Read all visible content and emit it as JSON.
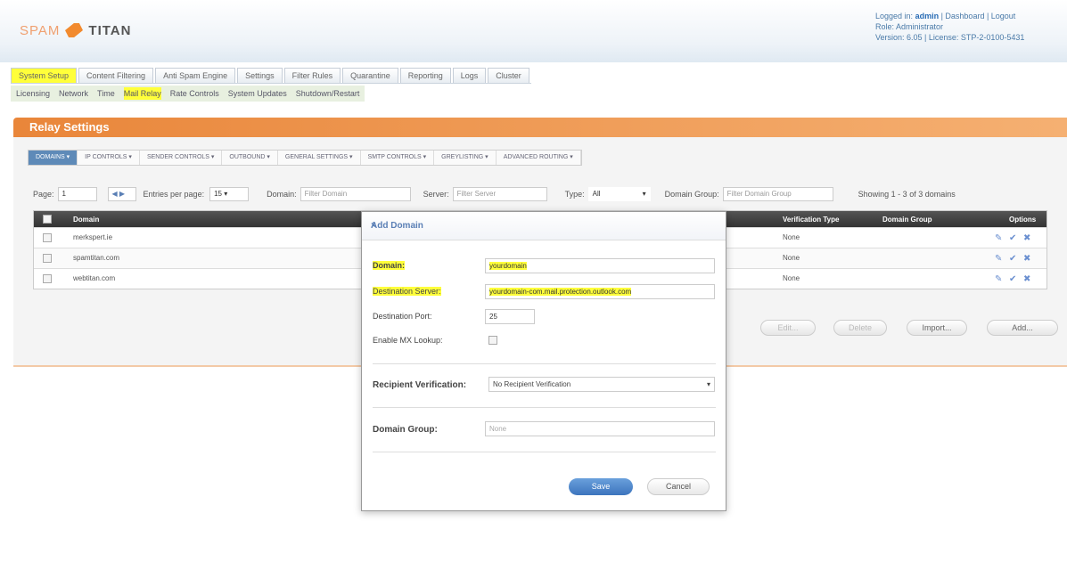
{
  "header": {
    "logo_spam": "SPAM",
    "logo_titan": "TITAN",
    "logged_in_prefix": "Logged in:",
    "logged_in_user": "admin",
    "logged_in_links": " | Dashboard | Logout",
    "role": "Role: Administrator",
    "version": "Version: 6.05 | License: STP-2-0100-5431"
  },
  "main_nav": [
    "System Setup",
    "Content Filtering",
    "Anti Spam Engine",
    "Settings",
    "Filter Rules",
    "Quarantine",
    "Reporting",
    "Logs",
    "Cluster"
  ],
  "sub_nav": [
    "Licensing",
    "Network",
    "Time",
    "Mail Relay",
    "Rate Controls",
    "System Updates",
    "Shutdown/Restart"
  ],
  "panel": {
    "title": "Relay Settings",
    "toolbar": [
      "DOMAINS ▾",
      "IP CONTROLS ▾",
      "SENDER CONTROLS ▾",
      "OUTBOUND ▾",
      "GENERAL SETTINGS ▾",
      "SMTP CONTROLS ▾",
      "GREYLISTING ▾",
      "ADVANCED ROUTING ▾"
    ],
    "filters": {
      "page_label": "Page:",
      "page_value": "1",
      "entries_label": "Entries per page:",
      "entries_value": "15",
      "domain_label": "Domain:",
      "domain_placeholder": "Filter Domain",
      "server_label": "Server:",
      "server_placeholder": "Filter Server",
      "type_label": "Type:",
      "type_value": "All",
      "group_label": "Domain Group:",
      "group_placeholder": "Filter Domain Group",
      "showing": "Showing 1 - 3 of 3 domains"
    },
    "columns": [
      "Domain",
      "Verification Type",
      "Domain Group",
      "Options"
    ],
    "rows": [
      {
        "domain": "merkspert.ie",
        "verification": "None"
      },
      {
        "domain": "spamtitan.com",
        "verification": "None"
      },
      {
        "domain": "webtitan.com",
        "verification": "None"
      }
    ],
    "buttons": {
      "edit": "Edit...",
      "delete": "Delete",
      "import": "Import...",
      "add": "Add..."
    }
  },
  "modal": {
    "title": "Add Domain",
    "close": "×",
    "domain_label": "Domain:",
    "domain_value": "yourdomain",
    "server_label": "Destination Server:",
    "server_value": "yourdomain-com.mail.protection.outlook.com",
    "port_label": "Destination Port:",
    "port_value": "25",
    "mx_label": "Enable MX Lookup:",
    "recipient_label": "Recipient Verification:",
    "recipient_value": "No Recipient Verification",
    "group_label": "Domain Group:",
    "group_placeholder": "None",
    "save": "Save",
    "cancel": "Cancel"
  }
}
